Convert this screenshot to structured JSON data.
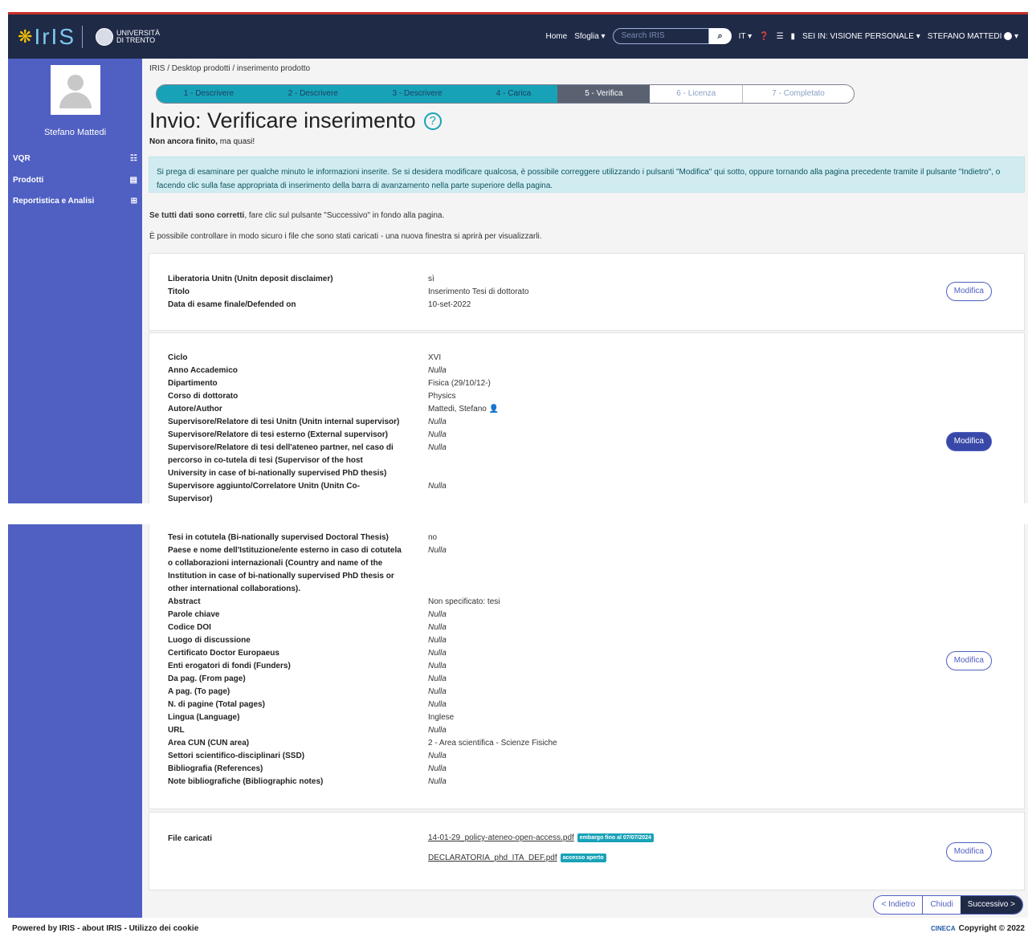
{
  "navbar": {
    "logo_text": "IrIS",
    "university": [
      "UNIVERSITÀ",
      "DI TRENTO"
    ],
    "home": "Home",
    "browse": "Sfoglia",
    "search_placeholder": "Search IRIS",
    "lang": "IT",
    "view": "SEI IN: VISIONE PERSONALE",
    "user": "STEFANO MATTEDI"
  },
  "sidebar": {
    "user_name": "Stefano Mattedi",
    "items": [
      {
        "label": "VQR",
        "icon": "list-icon"
      },
      {
        "label": "Prodotti",
        "icon": "document-icon"
      },
      {
        "label": "Reportistica e Analisi",
        "icon": "table-icon"
      }
    ]
  },
  "breadcrumb": "IRIS / Desktop prodotti / inserimento prodotto",
  "steps": [
    "1 - Descrivere",
    "2 - Descrivere",
    "3 - Descrivere",
    "4 - Carica",
    "5 - Verifica",
    "6 - Licenza",
    "7 - Completato"
  ],
  "page": {
    "title": "Invio: Verificare inserimento",
    "subtitle_bold": "Non ancora finito,",
    "subtitle_rest": " ma quasi!",
    "alert": "Si prega di esaminare per qualche minuto le informazioni inserite. Se si desidera modificare qualcosa, è possibile correggere utilizzando i pulsanti \"Modifica\" qui sotto, oppure tornando alla pagina precedente tramite il pulsante \"Indietro\", o facendo clic sulla fase appropriata di inserimento della barra di avanzamento nella parte superiore della pagina.",
    "p1_bold": "Se tutti dati sono corretti",
    "p1_rest": ", fare clic sul pulsante \"Successivo\" in fondo alla pagina.",
    "p2": "È possibile controllare in modo sicuro i file che sono stati caricati - una nuova finestra si aprirà per visualizzarli."
  },
  "card1": {
    "rows": [
      {
        "label": "Liberatoria Unitn (Unitn deposit disclaimer)",
        "value": "sì"
      },
      {
        "label": "Titolo",
        "value": "Inserimento Tesi di dottorato"
      },
      {
        "label": "Data di esame finale/Defended on",
        "value": "10-set-2022"
      }
    ],
    "edit": "Modifica"
  },
  "card2": {
    "rows": [
      {
        "label": "Ciclo",
        "value": "XVI"
      },
      {
        "label": "Anno Accademico",
        "value": "Nulla"
      },
      {
        "label": "Dipartimento",
        "value": "Fisica (29/10/12-)"
      },
      {
        "label": "Corso di dottorato",
        "value": "Physics"
      },
      {
        "label": "Autore/Author",
        "value": "Mattedi, Stefano"
      },
      {
        "label": "Supervisore/Relatore di tesi Unitn (Unitn internal supervisor)",
        "value": "Nulla"
      },
      {
        "label": "Supervisore/Relatore di tesi esterno (External supervisor)",
        "value": "Nulla"
      },
      {
        "label": "Supervisore/Relatore di tesi dell'ateneo partner, nel caso di",
        "value": "Nulla"
      },
      {
        "label": "percorso in co-tutela di tesi (Supervisor of the host",
        "value": ""
      },
      {
        "label": "University in case of bi-nationally supervised PhD thesis)",
        "value": ""
      },
      {
        "label": "Supervisore aggiunto/Correlatore Unitn (Unitn Co-",
        "value": "Nulla"
      },
      {
        "label": "Supervisor)",
        "value": ""
      }
    ],
    "edit": "Modifica"
  },
  "card3": {
    "rows": [
      {
        "label": "Tesi in cotutela (Bi-nationally supervised Doctoral Thesis)",
        "value": "no"
      },
      {
        "label": "Paese e nome dell'Istituzione/ente esterno in caso di cotutela",
        "value": "Nulla"
      },
      {
        "label": "o collaborazioni internazionali (Country and name of the",
        "value": ""
      },
      {
        "label": "Institution in case of bi-nationally supervised PhD thesis or",
        "value": ""
      },
      {
        "label": "other international collaborations).",
        "value": ""
      },
      {
        "label": "Abstract",
        "value": "Non specificato: tesi"
      },
      {
        "label": "Parole chiave",
        "value": "Nulla"
      },
      {
        "label": "Codice DOI",
        "value": "Nulla"
      },
      {
        "label": "Luogo di discussione",
        "value": "Nulla"
      },
      {
        "label": "Certificato Doctor Europaeus",
        "value": "Nulla"
      },
      {
        "label": "Enti erogatori di fondi (Funders)",
        "value": "Nulla"
      },
      {
        "label": "Da pag. (From page)",
        "value": "Nulla"
      },
      {
        "label": "A pag. (To page)",
        "value": "Nulla"
      },
      {
        "label": "N. di pagine (Total pages)",
        "value": "Nulla"
      },
      {
        "label": "Lingua (Language)",
        "value": "Inglese"
      },
      {
        "label": "URL",
        "value": "Nulla"
      },
      {
        "label": "Area CUN (CUN area)",
        "value": "2 - Area scientifica - Scienze Fisiche"
      },
      {
        "label": "Settori scientifico-disciplinari (SSD)",
        "value": "Nulla"
      },
      {
        "label": "Bibliografia (References)",
        "value": "Nulla"
      },
      {
        "label": "Note bibliografiche (Bibliographic notes)",
        "value": "Nulla"
      }
    ],
    "edit": "Modifica"
  },
  "card4": {
    "label": "File caricati",
    "files": [
      {
        "name": "14-01-29_policy-ateneo-open-access.pdf",
        "badge": "embargo fino al 07/07/2024"
      },
      {
        "name": "DECLARATORIA_phd_ITA_DEF.pdf",
        "badge": "accesso aperto"
      }
    ],
    "edit": "Modifica"
  },
  "buttons": {
    "back": "< Indietro",
    "close": "Chiudi",
    "next": "Successivo >"
  },
  "footer": {
    "left": "Powered by IRIS  -  about IRIS  -  Utilizzo dei cookie",
    "cineca": "CINECA",
    "copyright": "Copyright © 2022"
  },
  "colors": {
    "navbar": "#1f2a47",
    "sidebar": "#4f5fc2",
    "step_active": "#17a2b8",
    "step_current": "#5a6272"
  }
}
